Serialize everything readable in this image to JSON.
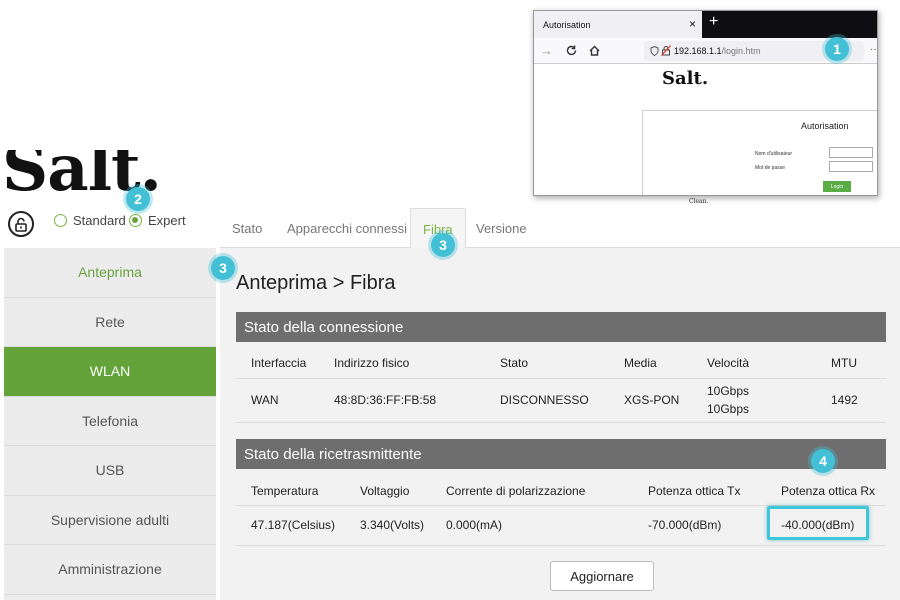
{
  "browser": {
    "tab_title": "Autorisation",
    "tab_close": "×",
    "new_tab": "+",
    "url_host": "192.168.1.1",
    "url_path": "/login.htm",
    "menu_dots": "··",
    "logo": "Salt.",
    "auth_title": "Autorisation",
    "username_label": "Nom d'utilisateur",
    "password_label": "Mot de passe",
    "login_button": "Login",
    "tagline": "Clean."
  },
  "brand": {
    "logo": "Salt."
  },
  "mode": {
    "standard": "Standard",
    "expert": "Expert",
    "selected": "Expert"
  },
  "tabs": [
    "Stato",
    "Apparecchi connessi",
    "Fibra",
    "Versione"
  ],
  "active_tab": "Fibra",
  "sidebar": [
    {
      "label": "Anteprima"
    },
    {
      "label": "Rete"
    },
    {
      "label": "WLAN"
    },
    {
      "label": "Telefonia"
    },
    {
      "label": "USB"
    },
    {
      "label": "Supervisione adulti"
    },
    {
      "label": "Amministrazione"
    }
  ],
  "main": {
    "title": "Anteprima > Fibra",
    "connection": {
      "header": "Stato della connessione",
      "columns": [
        "Interfaccia",
        "Indirizzo fisico",
        "Stato",
        "Media",
        "Velocità",
        "MTU"
      ],
      "row": {
        "interface": "WAN",
        "mac": "48:8D:36:FF:FB:58",
        "state": "DISCONNESSO",
        "media": "XGS-PON",
        "speed_1": "10Gbps",
        "speed_2": "10Gbps",
        "mtu": "1492"
      }
    },
    "transceiver": {
      "header": "Stato della ricetrasmittente",
      "columns": [
        "Temperatura",
        "Voltaggio",
        "Corrente di polarizzazione",
        "Potenza ottica Tx",
        "Potenza ottica Rx"
      ],
      "row": {
        "temperature": "47.187(Celsius)",
        "voltage": "3.340(Volts)",
        "bias": "0.000(mA)",
        "tx": "-70.000(dBm)",
        "rx": "-40.000(dBm)"
      }
    },
    "refresh_button": "Aggiornare"
  },
  "badges": [
    "1",
    "2",
    "3",
    "3",
    "4"
  ],
  "colors": {
    "accent_green": "#63a33a",
    "badge_cyan": "#44c0d6",
    "header_gray": "#6e6e6e"
  }
}
